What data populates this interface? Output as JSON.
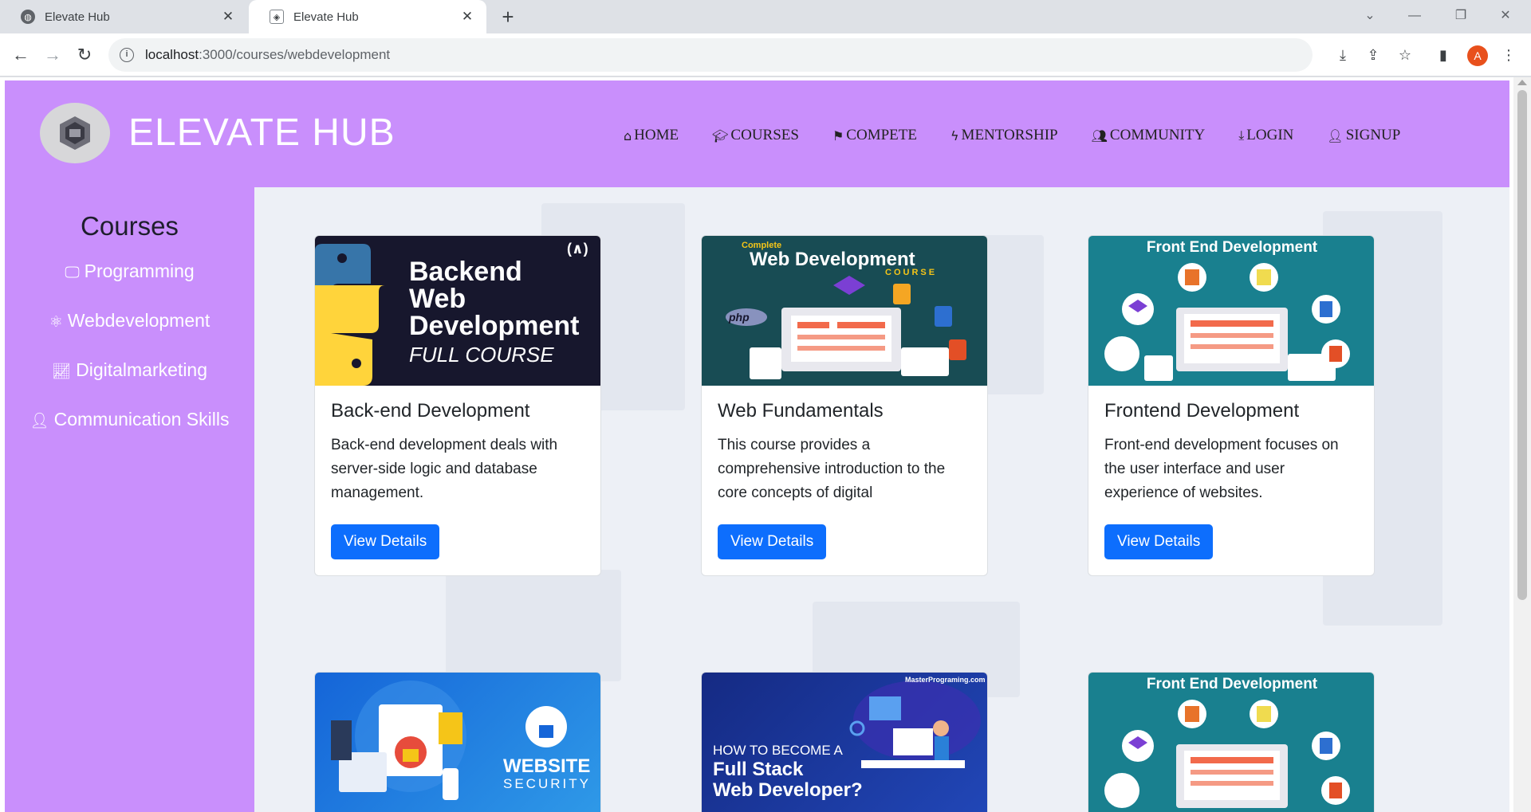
{
  "browser": {
    "tabs": [
      {
        "title": "Elevate Hub",
        "active": false
      },
      {
        "title": "Elevate Hub",
        "active": true
      }
    ],
    "url_host": "localhost",
    "url_path": ":3000/courses/webdevelopment",
    "profile_initial": "A"
  },
  "header": {
    "brand": "ELEVATE HUB",
    "nav": [
      {
        "icon": "home-icon",
        "label": "HOME"
      },
      {
        "icon": "graduation-cap-icon",
        "label": "COURSES"
      },
      {
        "icon": "flag-icon",
        "label": "COMPETE"
      },
      {
        "icon": "bolt-icon",
        "label": "MENTORSHIP"
      },
      {
        "icon": "users-icon",
        "label": "COMMUNITY"
      },
      {
        "icon": "download-icon",
        "label": "LOGIN"
      },
      {
        "icon": "user-plus-icon",
        "label": "SIGNUP"
      }
    ]
  },
  "sidebar": {
    "title": "Courses",
    "items": [
      {
        "icon": "monitor-icon",
        "label": "Programming"
      },
      {
        "icon": "atom-icon",
        "label": "Webdevelopment"
      },
      {
        "icon": "trending-up-icon",
        "label": "Digitalmarketing"
      },
      {
        "icon": "user-icon",
        "label": "Communication Skills"
      }
    ]
  },
  "cards": [
    {
      "thumb": "backend",
      "thumb_text": [
        "Backend",
        "Web",
        "Development",
        "FULL COURSE"
      ],
      "title": "Back-end Development",
      "desc": "Back-end development deals with server-side logic and database management.",
      "button": "View Details"
    },
    {
      "thumb": "webfund",
      "thumb_text": [
        "Complete",
        "Web Development",
        "COURSE",
        "php"
      ],
      "title": "Web Fundamentals",
      "desc": "This course provides a comprehensive introduction to the core concepts of digital",
      "button": "View Details"
    },
    {
      "thumb": "frontend",
      "thumb_text": [
        "Front End Development",
        "JS",
        "CSS",
        "HTML"
      ],
      "title": "Frontend Development",
      "desc": "Front-end development focuses on the user interface and user experience of websites.",
      "button": "View Details"
    },
    {
      "thumb": "security",
      "thumb_text": [
        "WEBSITE",
        "SECURITY"
      ]
    },
    {
      "thumb": "fullstack",
      "thumb_text": [
        "MasterPrograming.com",
        "HOW TO BECOME A",
        "Full Stack",
        "Web Developer?"
      ]
    },
    {
      "thumb": "frontend",
      "thumb_text": [
        "Front End Development",
        "JS",
        "CSS",
        "HTML"
      ]
    }
  ],
  "colors": {
    "header_bg": "#c98ffc",
    "main_bg": "#edf0f6",
    "button": "#0d6efd"
  }
}
